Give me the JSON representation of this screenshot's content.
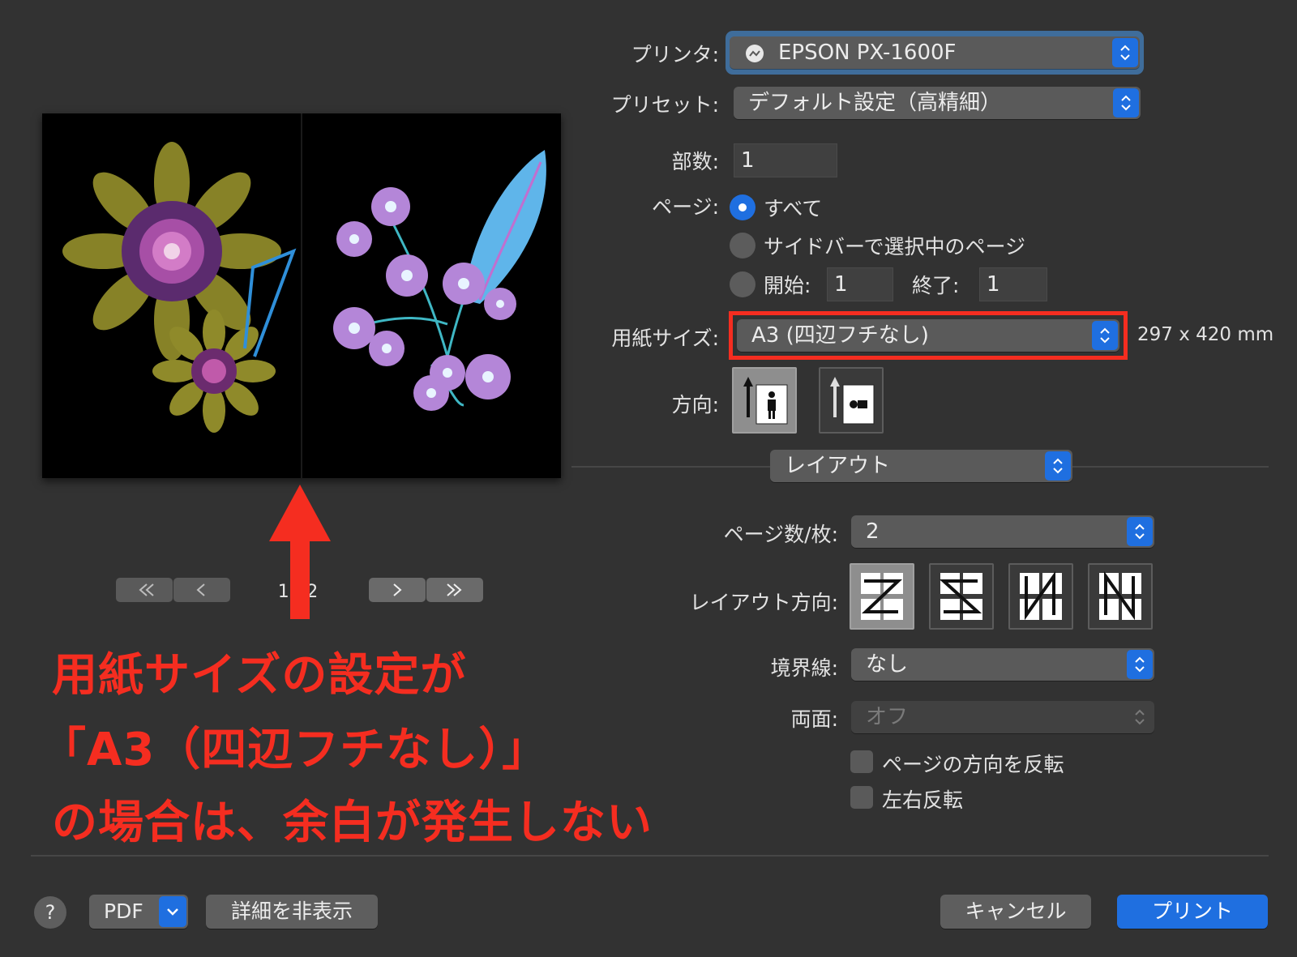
{
  "printer": {
    "label": "プリンタ:",
    "value": "EPSON PX-1600F"
  },
  "preset": {
    "label": "プリセット:",
    "value": "デフォルト設定（高精細）"
  },
  "copies": {
    "label": "部数:",
    "value": "1"
  },
  "pages": {
    "label": "ページ:",
    "all": "すべて",
    "sidebar": "サイドバーで選択中のページ",
    "from_label": "開始:",
    "from_value": "1",
    "to_label": "終了:",
    "to_value": "1"
  },
  "paper": {
    "label": "用紙サイズ:",
    "value": "A3 (四辺フチなし)",
    "dimensions": "297 x 420 mm"
  },
  "orientation": {
    "label": "方向:"
  },
  "section": {
    "value": "レイアウト"
  },
  "layout": {
    "pages_per_sheet_label": "ページ数/枚:",
    "pages_per_sheet_value": "2",
    "direction_label": "レイアウト方向:",
    "border_label": "境界線:",
    "border_value": "なし",
    "two_sided_label": "両面:",
    "two_sided_value": "オフ",
    "reverse_orientation": "ページの方向を反転",
    "flip_horizontal": "左右反転"
  },
  "preview": {
    "page_indicator": "1 / 2"
  },
  "footer": {
    "help": "?",
    "pdf": "PDF",
    "hide_details": "詳細を非表示",
    "cancel": "キャンセル",
    "print": "プリント"
  },
  "annotation": {
    "line1": "用紙サイズの設定が",
    "line2": "「A3（四辺フチなし）」",
    "line3": "の場合は、余白が発生しない"
  },
  "colors": {
    "accent": "#1f6fe0",
    "highlight": "#f52d20",
    "background": "#323232"
  }
}
